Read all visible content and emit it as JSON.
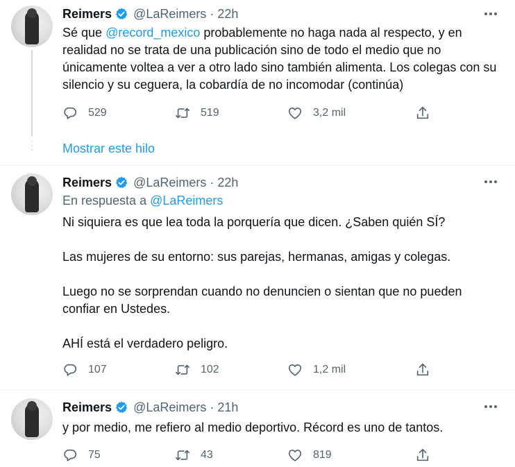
{
  "accent_color": "#1d9bf0",
  "tweets": [
    {
      "name": "Reimers",
      "handle": "@LaReimers",
      "separator": "·",
      "time": "22h",
      "mention": "@record_mexico",
      "text_before": "Sé que ",
      "text_after": " probablemente no haga nada al respecto, y en realidad no se trata de una publicación sino de todo el medio que no únicamente voltea a ver a otro lado sino también alimenta. Los colegas con su silencio y su ceguera, la cobardía de no incomodar (continúa)",
      "replies": "529",
      "retweets": "519",
      "likes": "3,2 mil"
    },
    {
      "name": "Reimers",
      "handle": "@LaReimers",
      "separator": "·",
      "time": "22h",
      "reply_prefix": "En respuesta a ",
      "reply_handle": "@LaReimers",
      "paragraphs": [
        "Ni siquiera es que lea toda la porquería que dicen. ¿Saben quién SÍ?",
        "Las mujeres de su entorno: sus parejas, hermanas, amigas y colegas.",
        "Luego no se sorprendan cuando no denuncien o sientan que no pueden confiar en Ustedes.",
        "AHÍ está el verdadero peligro."
      ],
      "replies": "107",
      "retweets": "102",
      "likes": "1,2 mil"
    },
    {
      "name": "Reimers",
      "handle": "@LaReimers",
      "separator": "·",
      "time": "21h",
      "text": "y por medio, me refiero al medio deportivo. Récord es uno de tantos.",
      "replies": "75",
      "retweets": "43",
      "likes": "819"
    }
  ],
  "show_thread": "Mostrar este hilo",
  "icons": [
    "reply-icon",
    "retweet-icon",
    "like-icon",
    "share-icon",
    "verified-badge-icon",
    "more-icon"
  ]
}
